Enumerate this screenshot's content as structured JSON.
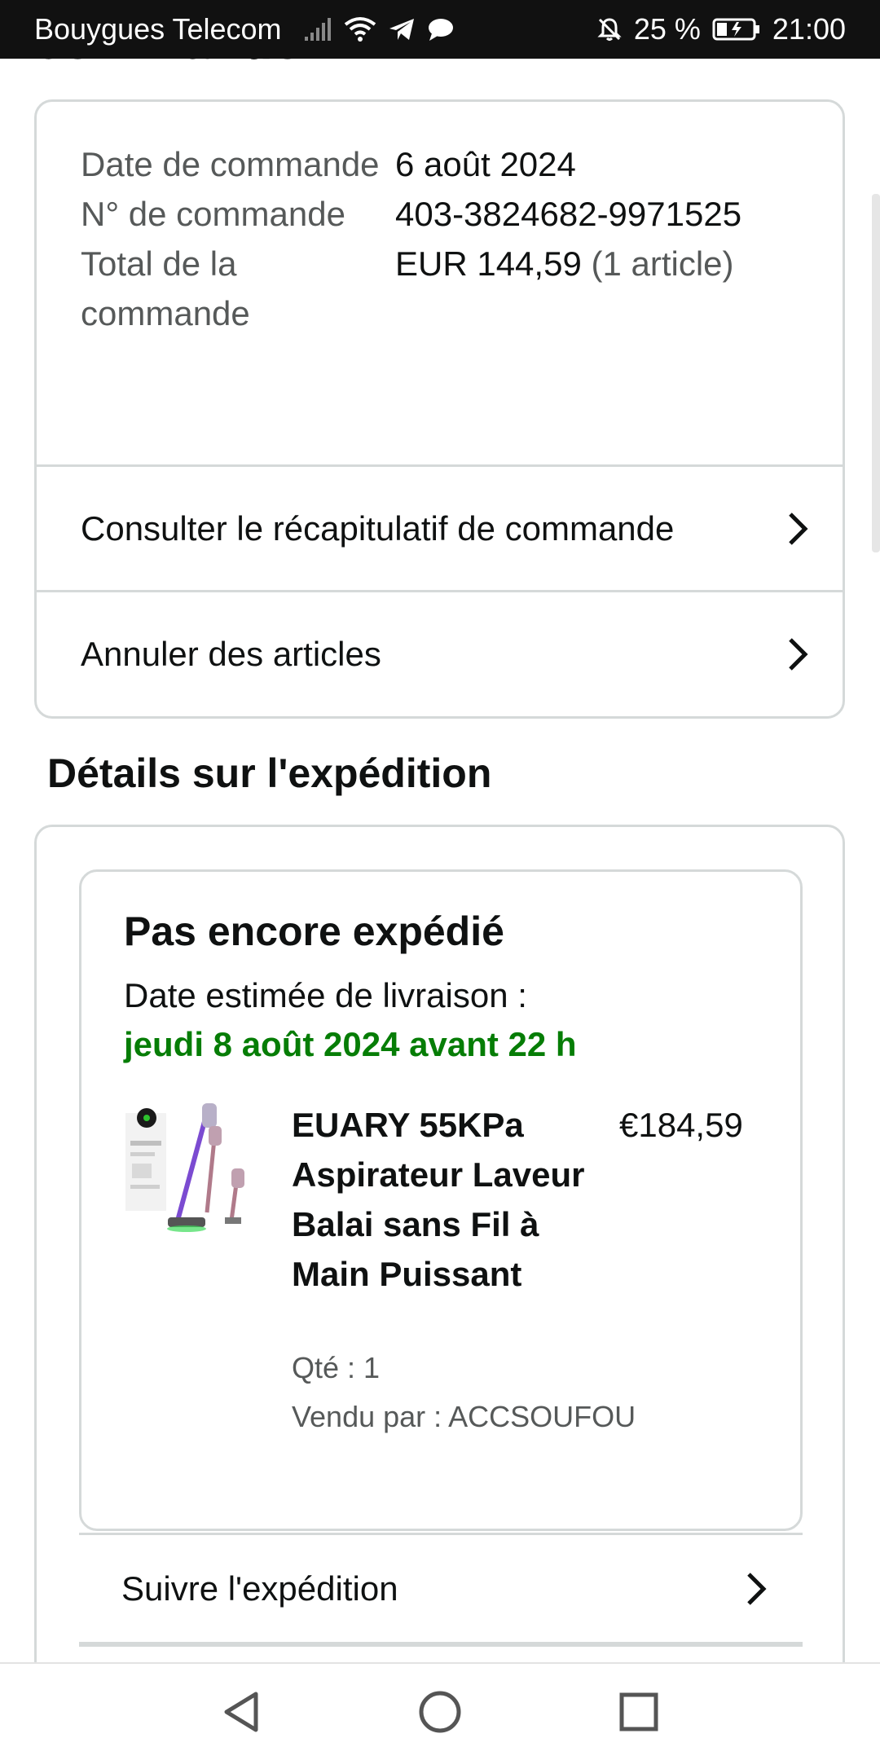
{
  "status_bar": {
    "carrier": "Bouygues Telecom",
    "battery": "25 %",
    "time": "21:00",
    "icons": [
      "signal-icon",
      "wifi-icon",
      "telegram-icon",
      "chat-icon",
      "mute-bell-icon",
      "battery-icon"
    ]
  },
  "page": {
    "cut_heading": "commande"
  },
  "summary": {
    "rows": [
      {
        "label": "Date de commande",
        "value": "6 août 2024",
        "extra": ""
      },
      {
        "label": "N° de commande",
        "value": "403-3824682-9971525",
        "extra": ""
      },
      {
        "label": "Total de la commande",
        "value": "EUR 144,59",
        "extra": "(1 article)"
      }
    ],
    "links": [
      "Consulter le récapitulatif de commande",
      "Annuler des articles"
    ]
  },
  "shipping": {
    "title": "Détails sur l'expédition",
    "status": "Pas encore expédié",
    "estimate_label": "Date estimée de livraison :",
    "estimate_date": "jeudi 8 août 2024 avant 22 h",
    "date_color": "#067d06",
    "product": {
      "title": "EUARY 55KPa Aspirateur Laveur Balai sans Fil à Main Puissant",
      "price": "€184,59",
      "qty": "Qté : 1",
      "seller": "Vendu par : ACCSOUFOU"
    },
    "track_label": "Suivre l'expédition"
  },
  "nav_bar": {
    "buttons": [
      "back-icon",
      "home-icon",
      "recents-icon"
    ]
  }
}
